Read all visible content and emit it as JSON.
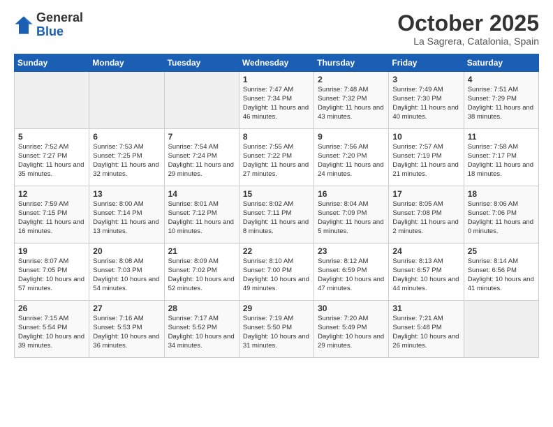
{
  "header": {
    "logo_general": "General",
    "logo_blue": "Blue",
    "month_title": "October 2025",
    "subtitle": "La Sagrera, Catalonia, Spain"
  },
  "days_of_week": [
    "Sunday",
    "Monday",
    "Tuesday",
    "Wednesday",
    "Thursday",
    "Friday",
    "Saturday"
  ],
  "weeks": [
    [
      {
        "day": "",
        "info": ""
      },
      {
        "day": "",
        "info": ""
      },
      {
        "day": "",
        "info": ""
      },
      {
        "day": "1",
        "info": "Sunrise: 7:47 AM\nSunset: 7:34 PM\nDaylight: 11 hours and 46 minutes."
      },
      {
        "day": "2",
        "info": "Sunrise: 7:48 AM\nSunset: 7:32 PM\nDaylight: 11 hours and 43 minutes."
      },
      {
        "day": "3",
        "info": "Sunrise: 7:49 AM\nSunset: 7:30 PM\nDaylight: 11 hours and 40 minutes."
      },
      {
        "day": "4",
        "info": "Sunrise: 7:51 AM\nSunset: 7:29 PM\nDaylight: 11 hours and 38 minutes."
      }
    ],
    [
      {
        "day": "5",
        "info": "Sunrise: 7:52 AM\nSunset: 7:27 PM\nDaylight: 11 hours and 35 minutes."
      },
      {
        "day": "6",
        "info": "Sunrise: 7:53 AM\nSunset: 7:25 PM\nDaylight: 11 hours and 32 minutes."
      },
      {
        "day": "7",
        "info": "Sunrise: 7:54 AM\nSunset: 7:24 PM\nDaylight: 11 hours and 29 minutes."
      },
      {
        "day": "8",
        "info": "Sunrise: 7:55 AM\nSunset: 7:22 PM\nDaylight: 11 hours and 27 minutes."
      },
      {
        "day": "9",
        "info": "Sunrise: 7:56 AM\nSunset: 7:20 PM\nDaylight: 11 hours and 24 minutes."
      },
      {
        "day": "10",
        "info": "Sunrise: 7:57 AM\nSunset: 7:19 PM\nDaylight: 11 hours and 21 minutes."
      },
      {
        "day": "11",
        "info": "Sunrise: 7:58 AM\nSunset: 7:17 PM\nDaylight: 11 hours and 18 minutes."
      }
    ],
    [
      {
        "day": "12",
        "info": "Sunrise: 7:59 AM\nSunset: 7:15 PM\nDaylight: 11 hours and 16 minutes."
      },
      {
        "day": "13",
        "info": "Sunrise: 8:00 AM\nSunset: 7:14 PM\nDaylight: 11 hours and 13 minutes."
      },
      {
        "day": "14",
        "info": "Sunrise: 8:01 AM\nSunset: 7:12 PM\nDaylight: 11 hours and 10 minutes."
      },
      {
        "day": "15",
        "info": "Sunrise: 8:02 AM\nSunset: 7:11 PM\nDaylight: 11 hours and 8 minutes."
      },
      {
        "day": "16",
        "info": "Sunrise: 8:04 AM\nSunset: 7:09 PM\nDaylight: 11 hours and 5 minutes."
      },
      {
        "day": "17",
        "info": "Sunrise: 8:05 AM\nSunset: 7:08 PM\nDaylight: 11 hours and 2 minutes."
      },
      {
        "day": "18",
        "info": "Sunrise: 8:06 AM\nSunset: 7:06 PM\nDaylight: 11 hours and 0 minutes."
      }
    ],
    [
      {
        "day": "19",
        "info": "Sunrise: 8:07 AM\nSunset: 7:05 PM\nDaylight: 10 hours and 57 minutes."
      },
      {
        "day": "20",
        "info": "Sunrise: 8:08 AM\nSunset: 7:03 PM\nDaylight: 10 hours and 54 minutes."
      },
      {
        "day": "21",
        "info": "Sunrise: 8:09 AM\nSunset: 7:02 PM\nDaylight: 10 hours and 52 minutes."
      },
      {
        "day": "22",
        "info": "Sunrise: 8:10 AM\nSunset: 7:00 PM\nDaylight: 10 hours and 49 minutes."
      },
      {
        "day": "23",
        "info": "Sunrise: 8:12 AM\nSunset: 6:59 PM\nDaylight: 10 hours and 47 minutes."
      },
      {
        "day": "24",
        "info": "Sunrise: 8:13 AM\nSunset: 6:57 PM\nDaylight: 10 hours and 44 minutes."
      },
      {
        "day": "25",
        "info": "Sunrise: 8:14 AM\nSunset: 6:56 PM\nDaylight: 10 hours and 41 minutes."
      }
    ],
    [
      {
        "day": "26",
        "info": "Sunrise: 7:15 AM\nSunset: 5:54 PM\nDaylight: 10 hours and 39 minutes."
      },
      {
        "day": "27",
        "info": "Sunrise: 7:16 AM\nSunset: 5:53 PM\nDaylight: 10 hours and 36 minutes."
      },
      {
        "day": "28",
        "info": "Sunrise: 7:17 AM\nSunset: 5:52 PM\nDaylight: 10 hours and 34 minutes."
      },
      {
        "day": "29",
        "info": "Sunrise: 7:19 AM\nSunset: 5:50 PM\nDaylight: 10 hours and 31 minutes."
      },
      {
        "day": "30",
        "info": "Sunrise: 7:20 AM\nSunset: 5:49 PM\nDaylight: 10 hours and 29 minutes."
      },
      {
        "day": "31",
        "info": "Sunrise: 7:21 AM\nSunset: 5:48 PM\nDaylight: 10 hours and 26 minutes."
      },
      {
        "day": "",
        "info": ""
      }
    ]
  ]
}
